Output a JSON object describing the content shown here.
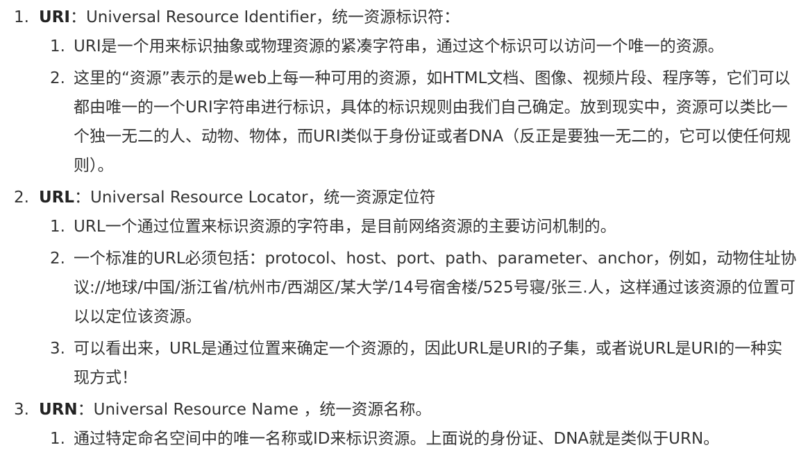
{
  "items": [
    {
      "number": "1.",
      "term": "URI",
      "desc": "：Universal Resource Identifier，统一资源标识符：",
      "subitems": [
        {
          "number": "1.",
          "text": "URI是一个用来标识抽象或物理资源的紧凑字符串，通过这个标识可以访问一个唯一的资源。"
        },
        {
          "number": "2.",
          "text": "这里的“资源”表示的是web上每一种可用的资源，如HTML文档、图像、视频片段、程序等，它们可以都由唯一的一个URI字符串进行标识，具体的标识规则由我们自己确定。放到现实中，资源可以类比一个独一无二的人、动物、物体，而URI类似于身份证或者DNA（反正是要独一无二的，它可以使任何规则）。"
        }
      ]
    },
    {
      "number": "2.",
      "term": "URL",
      "desc": "：Universal Resource Locator，统一资源定位符",
      "subitems": [
        {
          "number": "1.",
          "text": "URL一个通过位置来标识资源的字符串，是目前网络资源的主要访问机制的。"
        },
        {
          "number": "2.",
          "text": "一个标准的URL必须包括：protocol、host、port、path、parameter、anchor，例如，动物住址协议://地球/中国/浙江省/杭州市/西湖区/某大学/14号宿舍楼/525号寝/张三.人，这样通过该资源的位置可以以定位该资源。"
        },
        {
          "number": "3.",
          "text": "可以看出来，URL是通过位置来确定一个资源的，因此URL是URI的子集，或者说URL是URI的一种实现方式！"
        }
      ]
    },
    {
      "number": "3.",
      "term": "URN",
      "desc": "：Universal Resource Name ，统一资源名称。",
      "subitems": [
        {
          "number": "1.",
          "text": "通过特定命名空间中的唯一名称或ID来标识资源。上面说的身份证、DNA就是类似于URN。"
        }
      ]
    }
  ]
}
